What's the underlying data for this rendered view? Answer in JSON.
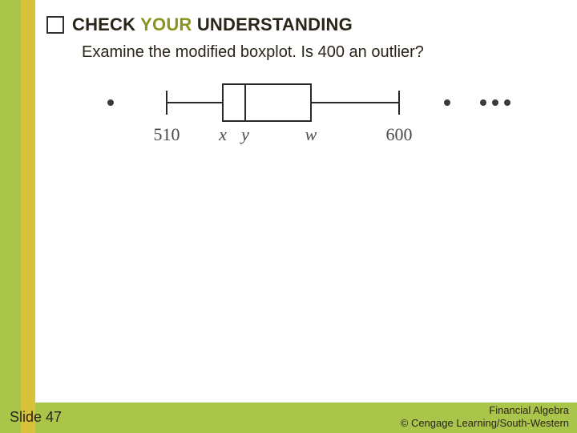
{
  "heading": {
    "prefix": "CHECK",
    "accent": " YOUR ",
    "suffix": "UNDERSTANDING"
  },
  "question": "Examine the modified boxplot. Is 400 an outlier?",
  "boxplot": {
    "whisker_low_label": "510",
    "whisker_high_label": "600",
    "q1_label": "x",
    "median_label": "y",
    "q3_label": "w",
    "outliers_right_count": 4,
    "outliers_left_count": 1
  },
  "footer": {
    "slide": "Slide 47",
    "line1": "Financial Algebra",
    "line2": "© Cengage Learning/South-Western"
  }
}
